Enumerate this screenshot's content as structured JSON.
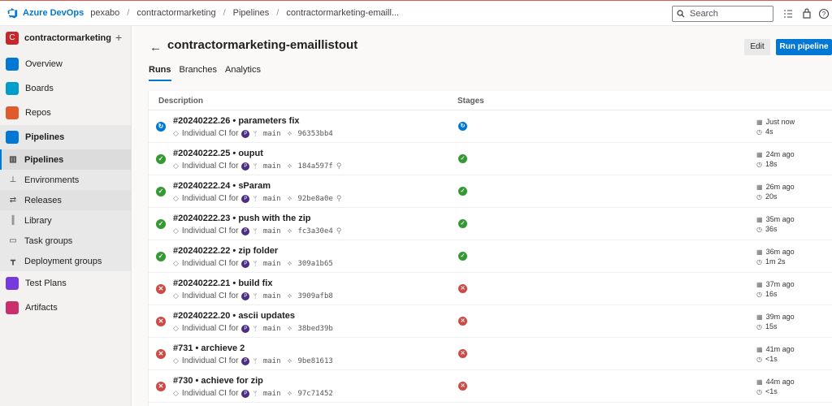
{
  "topbar": {
    "brand": "Azure DevOps",
    "org": "pexabo",
    "project": "contractormarketing",
    "section": "Pipelines",
    "pipeline_crumb": "contractormarketing-emaill...",
    "search_placeholder": "Search"
  },
  "sidebar": {
    "project_initial": "C",
    "project_name": "contractormarketing",
    "add_icon": "+",
    "items": [
      {
        "label": "Overview",
        "icon": "overview-icon",
        "color": "#0078d4"
      },
      {
        "label": "Boards",
        "icon": "boards-icon",
        "color": "#009ccc"
      },
      {
        "label": "Repos",
        "icon": "repos-icon",
        "color": "#e05a2b"
      },
      {
        "label": "Pipelines",
        "icon": "pipelines-icon",
        "color": "#0078d4"
      }
    ],
    "pipeline_subitems": [
      {
        "label": "Pipelines",
        "icon": "pipelines-sub-icon"
      },
      {
        "label": "Environments",
        "icon": "environments-icon"
      },
      {
        "label": "Releases",
        "icon": "releases-icon"
      },
      {
        "label": "Library",
        "icon": "library-icon"
      },
      {
        "label": "Task groups",
        "icon": "task-groups-icon"
      },
      {
        "label": "Deployment groups",
        "icon": "deployment-groups-icon"
      }
    ],
    "bottom_items": [
      {
        "label": "Test Plans",
        "icon": "test-plans-icon",
        "color": "#773adc"
      },
      {
        "label": "Artifacts",
        "icon": "artifacts-icon",
        "color": "#cb2e6d"
      }
    ]
  },
  "page": {
    "title": "contractormarketing-emaillistout",
    "edit_label": "Edit",
    "run_label": "Run pipeline",
    "tabs": [
      "Runs",
      "Branches",
      "Analytics"
    ],
    "active_tab": "Runs"
  },
  "table": {
    "col_description": "Description",
    "col_stages": "Stages",
    "trigger": "Individual CI for",
    "avatar_initial": "P",
    "branch": "main",
    "rows": [
      {
        "title": "#20240222.26 • parameters fix",
        "commit": "96353bb4",
        "status": "running",
        "time": "Just now",
        "duration": "4s",
        "pinned": false
      },
      {
        "title": "#20240222.25 • ouput",
        "commit": "184a597f",
        "status": "success",
        "time": "24m ago",
        "duration": "18s",
        "pinned": true
      },
      {
        "title": "#20240222.24 • sParam",
        "commit": "92be8a0e",
        "status": "success",
        "time": "26m ago",
        "duration": "20s",
        "pinned": true
      },
      {
        "title": "#20240222.23 • push with the zip",
        "commit": "fc3a30e4",
        "status": "success",
        "time": "35m ago",
        "duration": "36s",
        "pinned": true
      },
      {
        "title": "#20240222.22 • zip folder",
        "commit": "309a1b65",
        "status": "success",
        "time": "36m ago",
        "duration": "1m 2s",
        "pinned": false
      },
      {
        "title": "#20240222.21 • build fix",
        "commit": "3909afb8",
        "status": "failed",
        "time": "37m ago",
        "duration": "16s",
        "pinned": false
      },
      {
        "title": "#20240222.20 • ascii updates",
        "commit": "38bed39b",
        "status": "failed",
        "time": "39m ago",
        "duration": "15s",
        "pinned": false
      },
      {
        "title": "#731 • archieve 2",
        "commit": "9be81613",
        "status": "failed",
        "time": "41m ago",
        "duration": "<1s",
        "pinned": false
      },
      {
        "title": "#730 • achieve for zip",
        "commit": "97c71452",
        "status": "failed",
        "time": "44m ago",
        "duration": "<1s",
        "pinned": false
      }
    ]
  },
  "colors": {
    "accent": "#0078d4",
    "success": "#339933",
    "failed": "#cd4a45",
    "running": "#0078d4"
  }
}
